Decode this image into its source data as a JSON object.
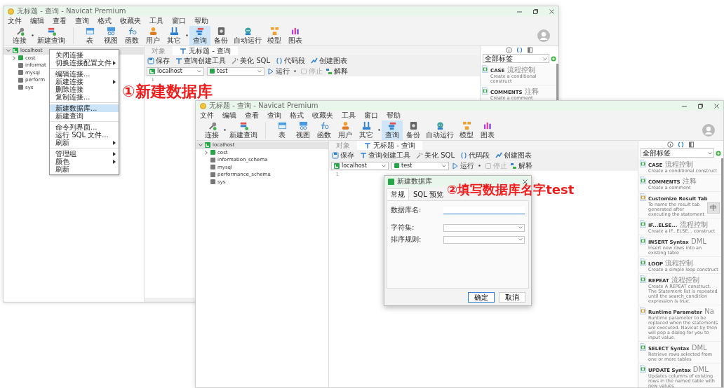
{
  "windows": [
    {
      "title": "无标题 - 查询 - Navicat Premium",
      "menu": [
        "文件",
        "编辑",
        "查看",
        "查询",
        "格式",
        "收藏夹",
        "工具",
        "窗口",
        "帮助"
      ],
      "toolbar": [
        {
          "label": "连接",
          "dropdown": true,
          "selected": false
        },
        {
          "label": "新建查询",
          "dropdown": false,
          "selected": false
        },
        {
          "label": "表",
          "dropdown": false,
          "selected": false
        },
        {
          "label": "视图",
          "dropdown": false,
          "selected": false
        },
        {
          "label": "函数",
          "dropdown": false,
          "selected": false
        },
        {
          "label": "用户",
          "dropdown": false,
          "selected": false
        },
        {
          "label": "其它",
          "dropdown": true,
          "selected": false
        },
        {
          "label": "查询",
          "dropdown": false,
          "selected": true
        },
        {
          "label": "备份",
          "dropdown": false,
          "selected": false
        },
        {
          "label": "自动运行",
          "dropdown": false,
          "selected": false
        },
        {
          "label": "模型",
          "dropdown": false,
          "selected": false
        },
        {
          "label": "图表",
          "dropdown": false,
          "selected": false
        }
      ],
      "tree": [
        {
          "label": "localhost",
          "kind": "connection",
          "expanded": true,
          "selected": true,
          "children": [
            {
              "label": "cost",
              "kind": "database",
              "open": true,
              "expanded": false
            },
            {
              "label": "informat",
              "kind": "database",
              "open": false
            },
            {
              "label": "mysql",
              "kind": "database",
              "open": false
            },
            {
              "label": "perform",
              "kind": "database",
              "open": false
            },
            {
              "label": "sys",
              "kind": "database",
              "open": false
            }
          ]
        }
      ],
      "tabs": [
        {
          "label": "对象",
          "selected": false
        },
        {
          "label": "无标题 - 查询",
          "selected": true
        }
      ],
      "query_toolbar": [
        "保存",
        "查询创建工具",
        "美化 SQL",
        "代码段",
        "创建图表"
      ],
      "connection_select": "localhost",
      "database_select": "test",
      "run": [
        {
          "label": "运行",
          "dropdown": true,
          "disabled": false
        },
        {
          "label": "停止",
          "dropdown": false,
          "disabled": true
        },
        {
          "label": "解释",
          "dropdown": false,
          "disabled": false
        }
      ],
      "line_numbers": [
        "1"
      ],
      "panel_tabs": [
        {
          "selected": false
        },
        {
          "selected": true
        },
        {
          "selected": false
        }
      ],
      "tag_filter": "全部标签",
      "snippets": [
        {
          "title": "CASE",
          "tag": "流程控制",
          "description": "Create a conditional construct",
          "color": "#3cb043"
        },
        {
          "title": "COMMENTS",
          "tag": "注释",
          "description": "Create a comment",
          "color": "#3cb043"
        }
      ]
    },
    {
      "title": "无标题 - 查询 - Navicat Premium",
      "menu": [
        "文件",
        "编辑",
        "查看",
        "查询",
        "格式",
        "收藏夹",
        "工具",
        "窗口",
        "帮助"
      ],
      "toolbar": [
        {
          "label": "连接",
          "dropdown": true,
          "selected": false
        },
        {
          "label": "新建查询",
          "dropdown": false,
          "selected": false
        },
        {
          "label": "表",
          "dropdown": false,
          "selected": false
        },
        {
          "label": "视图",
          "dropdown": false,
          "selected": false
        },
        {
          "label": "函数",
          "dropdown": false,
          "selected": false
        },
        {
          "label": "用户",
          "dropdown": false,
          "selected": false
        },
        {
          "label": "其它",
          "dropdown": true,
          "selected": false
        },
        {
          "label": "查询",
          "dropdown": false,
          "selected": true
        },
        {
          "label": "备份",
          "dropdown": false,
          "selected": false
        },
        {
          "label": "自动运行",
          "dropdown": false,
          "selected": false
        },
        {
          "label": "模型",
          "dropdown": false,
          "selected": false
        },
        {
          "label": "图表",
          "dropdown": false,
          "selected": false
        }
      ],
      "tree": [
        {
          "label": "localhost",
          "kind": "connection",
          "expanded": true,
          "selected": true,
          "children": [
            {
              "label": "cost",
              "kind": "database",
              "open": true,
              "expanded": false
            },
            {
              "label": "information_schema",
              "kind": "database",
              "open": false
            },
            {
              "label": "mysql",
              "kind": "database",
              "open": false
            },
            {
              "label": "performance_schema",
              "kind": "database",
              "open": false
            },
            {
              "label": "sys",
              "kind": "database",
              "open": false
            }
          ]
        }
      ],
      "tabs": [
        {
          "label": "对象",
          "selected": false
        },
        {
          "label": "无标题 - 查询",
          "selected": true
        }
      ],
      "query_toolbar": [
        "保存",
        "查询创建工具",
        "美化 SQL",
        "代码段",
        "创建图表"
      ],
      "connection_select": "localhost",
      "database_select": "test",
      "run": [
        {
          "label": "运行",
          "dropdown": true,
          "disabled": false
        },
        {
          "label": "停止",
          "dropdown": false,
          "disabled": true
        },
        {
          "label": "解释",
          "dropdown": false,
          "disabled": false
        }
      ],
      "line_numbers": [
        "1"
      ],
      "panel_tabs": [
        {
          "selected": false
        },
        {
          "selected": true
        },
        {
          "selected": false
        }
      ],
      "tag_filter": "全部标签",
      "snippets": [
        {
          "title": "CASE",
          "tag": "流程控制",
          "description": "Create a conditional construct",
          "color": "#3cb043"
        },
        {
          "title": "COMMENTS",
          "tag": "注释",
          "description": "Create a comment",
          "color": "#3cb043"
        },
        {
          "title": "Customize Result Tab",
          "description": "To name the result tab generated after executing the statement",
          "color": "#e0a020"
        },
        {
          "title": "IF...ELSE...",
          "tag": "流程控制",
          "description": "Create a IF...ELSE... construct",
          "color": "#3cb043"
        },
        {
          "title": "INSERT Syntax",
          "tag": "DML",
          "description": "Insert new rows into an existing table",
          "color": "#3cb043"
        },
        {
          "title": "LOOP",
          "tag": "流程控制",
          "description": "Create a simple loop construct",
          "color": "#3cb043"
        },
        {
          "title": "REPEAT",
          "tag": "流程控制",
          "description": "Create A REPEAT construct. The Statement list is repeated until the search_condition expression is true.",
          "color": "#3cb043"
        },
        {
          "title": "Runtime Parameter",
          "tag": "Na",
          "description": "Runtime parameter to be replaced when the statements are executed. Navicat by then will pop a dialog for you to input value.",
          "color": "#e0a020"
        },
        {
          "title": "SELECT Syntax",
          "tag": "DML",
          "description": "Retrieve rows selected from one or more tables",
          "color": "#3cb043"
        },
        {
          "title": "UPDATE Syntax",
          "tag": "DML",
          "description": "Updates columns of existing rows in the named table with new values",
          "color": "#3cb043"
        }
      ]
    }
  ],
  "context_menu": [
    {
      "kind": "item",
      "label": "关闭连接",
      "submenu": false,
      "selected": false
    },
    {
      "kind": "item",
      "label": "切换连接配置文件",
      "submenu": true,
      "selected": false
    },
    {
      "kind": "separator"
    },
    {
      "kind": "item",
      "label": "编辑连接...",
      "submenu": false,
      "selected": false
    },
    {
      "kind": "item",
      "label": "新建连接",
      "submenu": true,
      "selected": false
    },
    {
      "kind": "item",
      "label": "删除连接",
      "submenu": false,
      "selected": false
    },
    {
      "kind": "item",
      "label": "复制连接...",
      "submenu": false,
      "selected": false
    },
    {
      "kind": "separator"
    },
    {
      "kind": "item",
      "label": "新建数据库...",
      "submenu": false,
      "selected": true
    },
    {
      "kind": "item",
      "label": "新建查询",
      "submenu": false,
      "selected": false
    },
    {
      "kind": "separator"
    },
    {
      "kind": "item",
      "label": "命令列界面...",
      "submenu": false,
      "selected": false
    },
    {
      "kind": "item",
      "label": "运行 SQL 文件...",
      "submenu": false,
      "selected": false
    },
    {
      "kind": "item",
      "label": "刷新",
      "submenu": true,
      "selected": false
    },
    {
      "kind": "separator"
    },
    {
      "kind": "item",
      "label": "管理组",
      "submenu": true,
      "selected": false
    },
    {
      "kind": "item",
      "label": "颜色",
      "submenu": true,
      "selected": false
    },
    {
      "kind": "item",
      "label": "刷新",
      "submenu": false,
      "selected": false
    }
  ],
  "dialog": {
    "title": "新建数据库",
    "tabs": [
      {
        "label": "常规",
        "selected": true
      },
      {
        "label": "SQL 预览",
        "selected": false
      }
    ],
    "fields": [
      {
        "label": "数据库名:",
        "kind": "text",
        "focused": true
      },
      {
        "label": "字符集:",
        "kind": "select",
        "focused": false
      },
      {
        "label": "排序规则:",
        "kind": "select",
        "focused": false
      }
    ],
    "buttons": [
      {
        "label": "确定",
        "primary": true
      },
      {
        "label": "取消",
        "primary": false
      }
    ]
  },
  "annotations": [
    "①新建数据库",
    "②填写数据库名字test"
  ],
  "ime_badge": "中"
}
